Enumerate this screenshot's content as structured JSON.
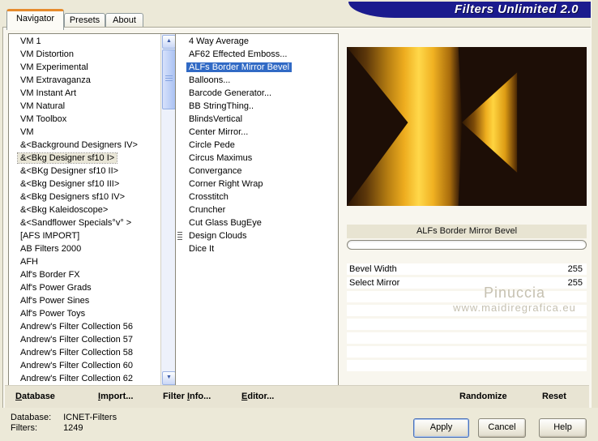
{
  "window": {
    "title": "Filters Unlimited 2.0"
  },
  "tabs": {
    "navigator": "Navigator",
    "presets": "Presets",
    "about": "About"
  },
  "category_list": {
    "items": [
      {
        "label": "VM 1"
      },
      {
        "label": "VM Distortion"
      },
      {
        "label": "VM Experimental"
      },
      {
        "label": "VM Extravaganza"
      },
      {
        "label": "VM Instant Art"
      },
      {
        "label": "VM Natural"
      },
      {
        "label": "VM Toolbox"
      },
      {
        "label": "VM"
      },
      {
        "label": "&<Background Designers IV>"
      },
      {
        "label": "&<Bkg Designer sf10 I>",
        "selected": true
      },
      {
        "label": "&<BKg Designer sf10 II>"
      },
      {
        "label": "&<Bkg Designer sf10 III>"
      },
      {
        "label": "&<Bkg Designers sf10 IV>"
      },
      {
        "label": "&<Bkg Kaleidoscope>"
      },
      {
        "label": "&<Sandflower Specials°v° >"
      },
      {
        "label": "[AFS IMPORT]"
      },
      {
        "label": "AB Filters 2000"
      },
      {
        "label": "AFH"
      },
      {
        "label": "Alf's Border FX"
      },
      {
        "label": "Alf's Power Grads"
      },
      {
        "label": "Alf's Power Sines"
      },
      {
        "label": "Alf's Power Toys"
      },
      {
        "label": "Andrew's Filter Collection 56"
      },
      {
        "label": "Andrew's Filter Collection 57"
      },
      {
        "label": "Andrew's Filter Collection 58"
      },
      {
        "label": "Andrew's Filter Collection 60"
      },
      {
        "label": "Andrew's Filter Collection 62"
      }
    ]
  },
  "filter_list": {
    "items": [
      {
        "label": "4 Way Average"
      },
      {
        "label": "AF62 Effected Emboss..."
      },
      {
        "label": "ALFs Border Mirror Bevel",
        "selected": true
      },
      {
        "label": "Balloons..."
      },
      {
        "label": "Barcode Generator..."
      },
      {
        "label": "BB StringThing.."
      },
      {
        "label": "BlindsVertical"
      },
      {
        "label": "Center Mirror..."
      },
      {
        "label": "Circle Pede"
      },
      {
        "label": "Circus Maximus"
      },
      {
        "label": "Convergance"
      },
      {
        "label": "Corner Right Wrap"
      },
      {
        "label": "Crosstitch"
      },
      {
        "label": "Cruncher"
      },
      {
        "label": "Cut Glass  BugEye"
      },
      {
        "label": "Design Clouds",
        "marked": true
      },
      {
        "label": "Dice It"
      }
    ]
  },
  "preview": {
    "filter_name": "ALFs Border Mirror Bevel"
  },
  "parameters": {
    "rows": [
      {
        "name": "Bevel Width",
        "value": "255"
      },
      {
        "name": "Select Mirror",
        "value": "255"
      },
      {
        "name": "",
        "value": ""
      },
      {
        "name": "",
        "value": ""
      },
      {
        "name": "",
        "value": ""
      },
      {
        "name": "",
        "value": ""
      },
      {
        "name": "",
        "value": ""
      },
      {
        "name": "",
        "value": ""
      }
    ]
  },
  "watermark": {
    "line1": "Pinuccia",
    "line2": "www.maidiregrafica.eu"
  },
  "toolbar": {
    "database": {
      "pre": "",
      "key": "D",
      "post": "atabase"
    },
    "import": {
      "pre": "",
      "key": "I",
      "post": "mport..."
    },
    "filter_info": {
      "pre": "Filter ",
      "key": "I",
      "post": "nfo..."
    },
    "editor": {
      "pre": "",
      "key": "E",
      "post": "ditor..."
    },
    "randomize": "Randomize",
    "reset": "Reset"
  },
  "statusbar": {
    "database_label": "Database:",
    "database_value": "ICNET-Filters",
    "filters_label": "Filters:",
    "filters_value": "1249",
    "apply": "Apply",
    "cancel": "Cancel",
    "help": "Help"
  },
  "colors": {
    "banner_blue": "#1b1b8e",
    "selection_blue": "#316ac5",
    "tab_accent_orange": "#e68b2c",
    "preview_gold": "#ffd84a",
    "dialog_beige": "#ece9d8"
  }
}
